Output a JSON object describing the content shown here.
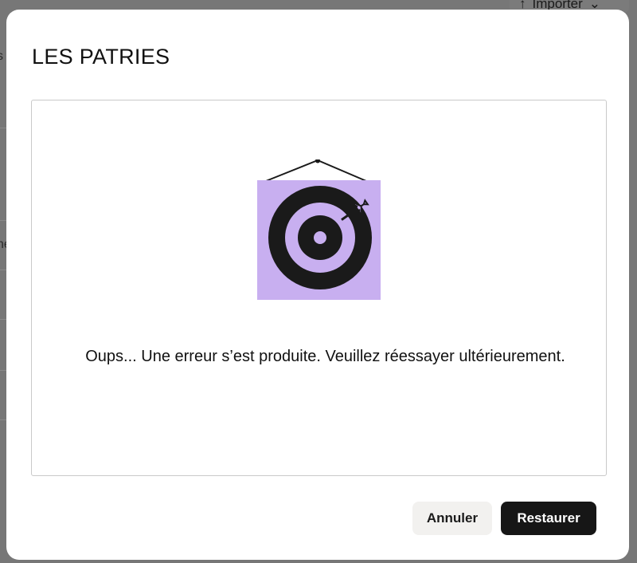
{
  "background": {
    "import_label": "Importer",
    "left_fragment_1": "s",
    "left_fragment_2": "ne"
  },
  "modal": {
    "title": "LES PATRIES",
    "error_message": "Oups... Une erreur s’est produite. Veuillez réessayer ultérieurement.",
    "illustration": "target-with-dart-illustration",
    "buttons": {
      "cancel_label": "Annuler",
      "restore_label": "Restaurer"
    }
  },
  "colors": {
    "poster": "#c8aff0",
    "target": "#1a1a1a",
    "primary_button": "#161616",
    "secondary_button": "#f2f1ef"
  }
}
